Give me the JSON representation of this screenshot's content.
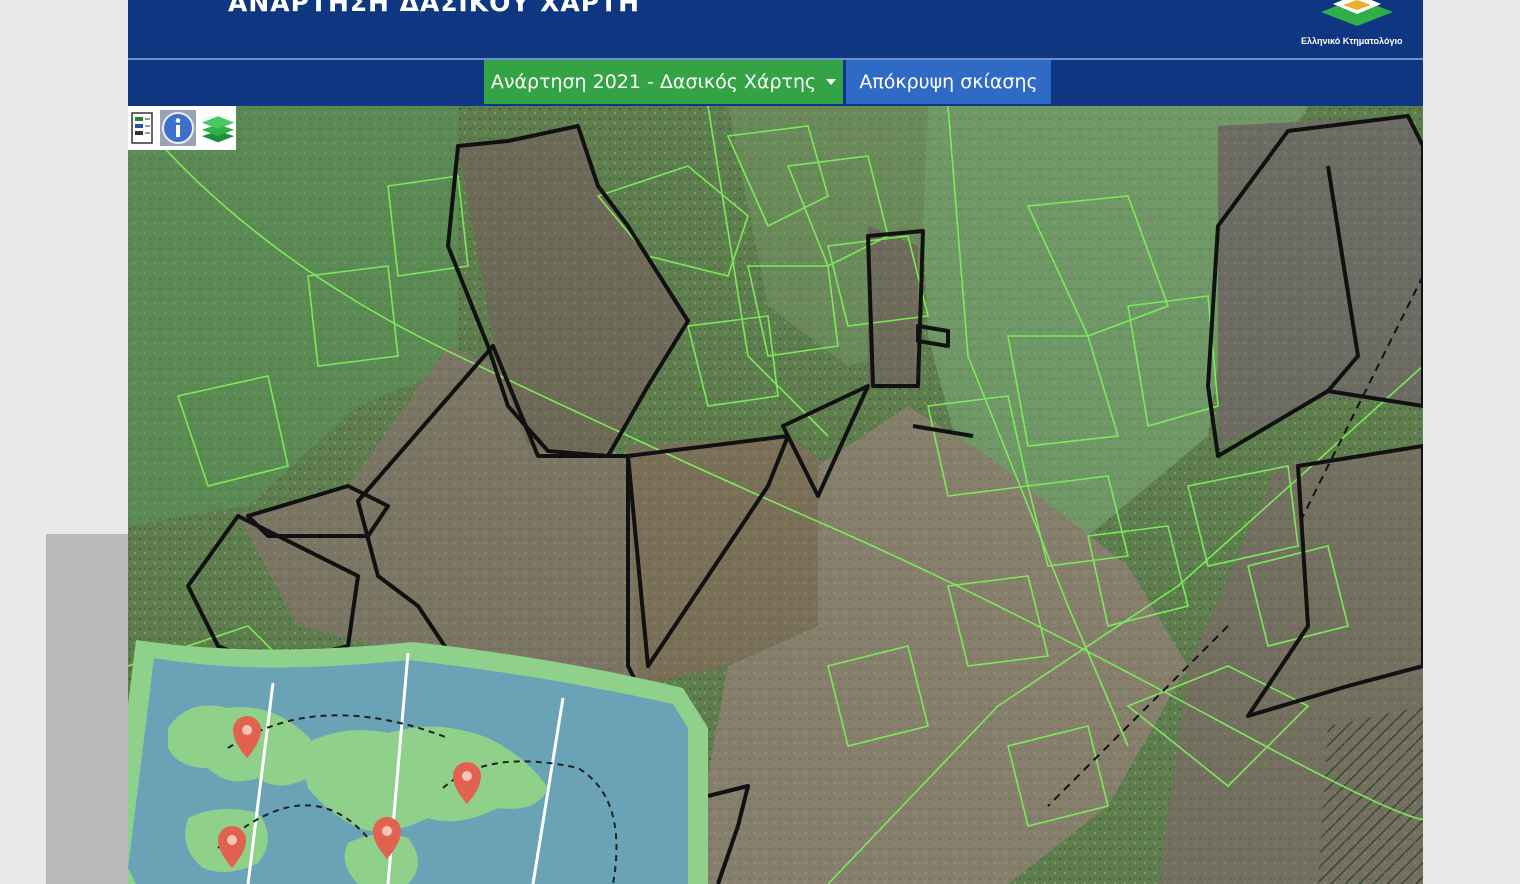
{
  "header": {
    "title": "ΑΝΑΡΤΗΣΗ ΔΑΣΙΚΟΥ ΧΑΡΤΗ",
    "logo_text": "Ελληνικό Κτηματολόγιο"
  },
  "navbar": {
    "map_selector_label": "Ανάρτηση 2021 - Δασικός Χάρτης",
    "hide_shading_label": "Απόκρυψη σκίασης"
  },
  "toolbar": {
    "icons": [
      "legend-icon",
      "info-icon",
      "layers-icon"
    ]
  },
  "colors": {
    "header_bg": "#0f3680",
    "map_button": "#33a345",
    "hide_button": "#2f6bc4",
    "parcel_outline": "#7cf05a",
    "forest_outline": "#111111"
  }
}
